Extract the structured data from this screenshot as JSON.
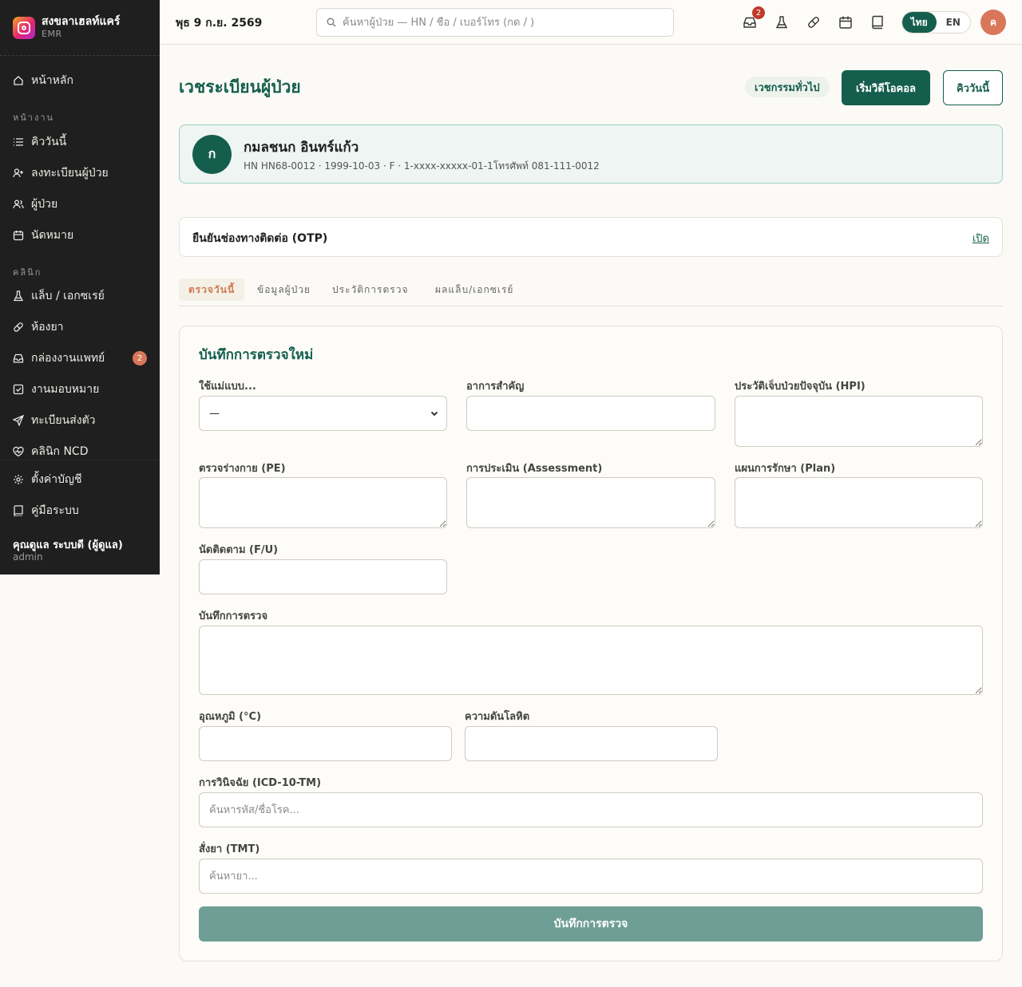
{
  "brand": {
    "name": "สงขลาเฮลท์แคร์",
    "sub": "EMR"
  },
  "sidebar": {
    "home": "หน้าหลัก",
    "section_work": "หน้างาน",
    "items_work": [
      {
        "label": "คิววันนี้"
      },
      {
        "label": "ลงทะเบียนผู้ป่วย"
      },
      {
        "label": "ผู้ป่วย"
      },
      {
        "label": "นัดหมาย"
      }
    ],
    "section_clinic": "คลินิก",
    "items_clinic": [
      {
        "label": "แล็บ / เอกซเรย์"
      },
      {
        "label": "ห้องยา"
      },
      {
        "label": "กล่องงานแพทย์",
        "badge": "2"
      },
      {
        "label": "งานมอบหมาย"
      },
      {
        "label": "ทะเบียนส่งตัว"
      },
      {
        "label": "คลินิก NCD"
      }
    ],
    "settings": "ตั้งค่าบัญชี",
    "manual": "คู่มือระบบ",
    "user_name": "คุณดูแล ระบบดี (ผู้ดูแล)",
    "user_role": "admin"
  },
  "topbar": {
    "date": "พุธ 9 ก.ย. 2569",
    "search_placeholder": "ค้นหาผู้ป่วย — HN / ชื่อ / เบอร์โทร (กด / )",
    "inbox_badge": "2",
    "lang_th": "ไทย",
    "lang_en": "EN",
    "avatar_initial": "ค"
  },
  "page": {
    "title": "เวชระเบียนผู้ป่วย",
    "dept": "เวชกรรมทั่วไป",
    "start_video": "เริ่มวิดีโอคอล",
    "queue_today": "คิววันนี้"
  },
  "patient": {
    "initial": "ก",
    "name": "กมลชนก อินทร์แก้ว",
    "meta": "HN HN68-0012 · 1999-10-03 · F · 1-xxxx-xxxxx-01-1โทรศัพท์ 081-111-0012"
  },
  "otp": {
    "title": "ยืนยันช่องทางติดต่อ (OTP)",
    "open": "เปิด"
  },
  "tabs": [
    "ตรวจวันนี้",
    "ข้อมูลผู้ป่วย",
    "ประวัติการตรวจ",
    "ผลแล็บ/เอกซเรย์"
  ],
  "form": {
    "title": "บันทึกการตรวจใหม่",
    "template_label": "ใช้แม่แบบ...",
    "template_value": "—",
    "cc_label": "อาการสำคัญ",
    "hpi_label": "ประวัติเจ็บป่วยปัจจุบัน (HPI)",
    "pe_label": "ตรวจร่างกาย (PE)",
    "assessment_label": "การประเมิน (Assessment)",
    "plan_label": "แผนการรักษา (Plan)",
    "fu_label": "นัดติดตาม (F/U)",
    "note_label": "บันทึกการตรวจ",
    "temp_label": "อุณหภูมิ (°C)",
    "bp_label": "ความดันโลหิต",
    "dx_label": "การวินิจฉัย (ICD-10-TM)",
    "dx_placeholder": "ค้นหารหัส/ชื่อโรค...",
    "rx_label": "สั่งยา (TMT)",
    "rx_placeholder": "ค้นหายา...",
    "submit": "บันทึกการตรวจ"
  }
}
